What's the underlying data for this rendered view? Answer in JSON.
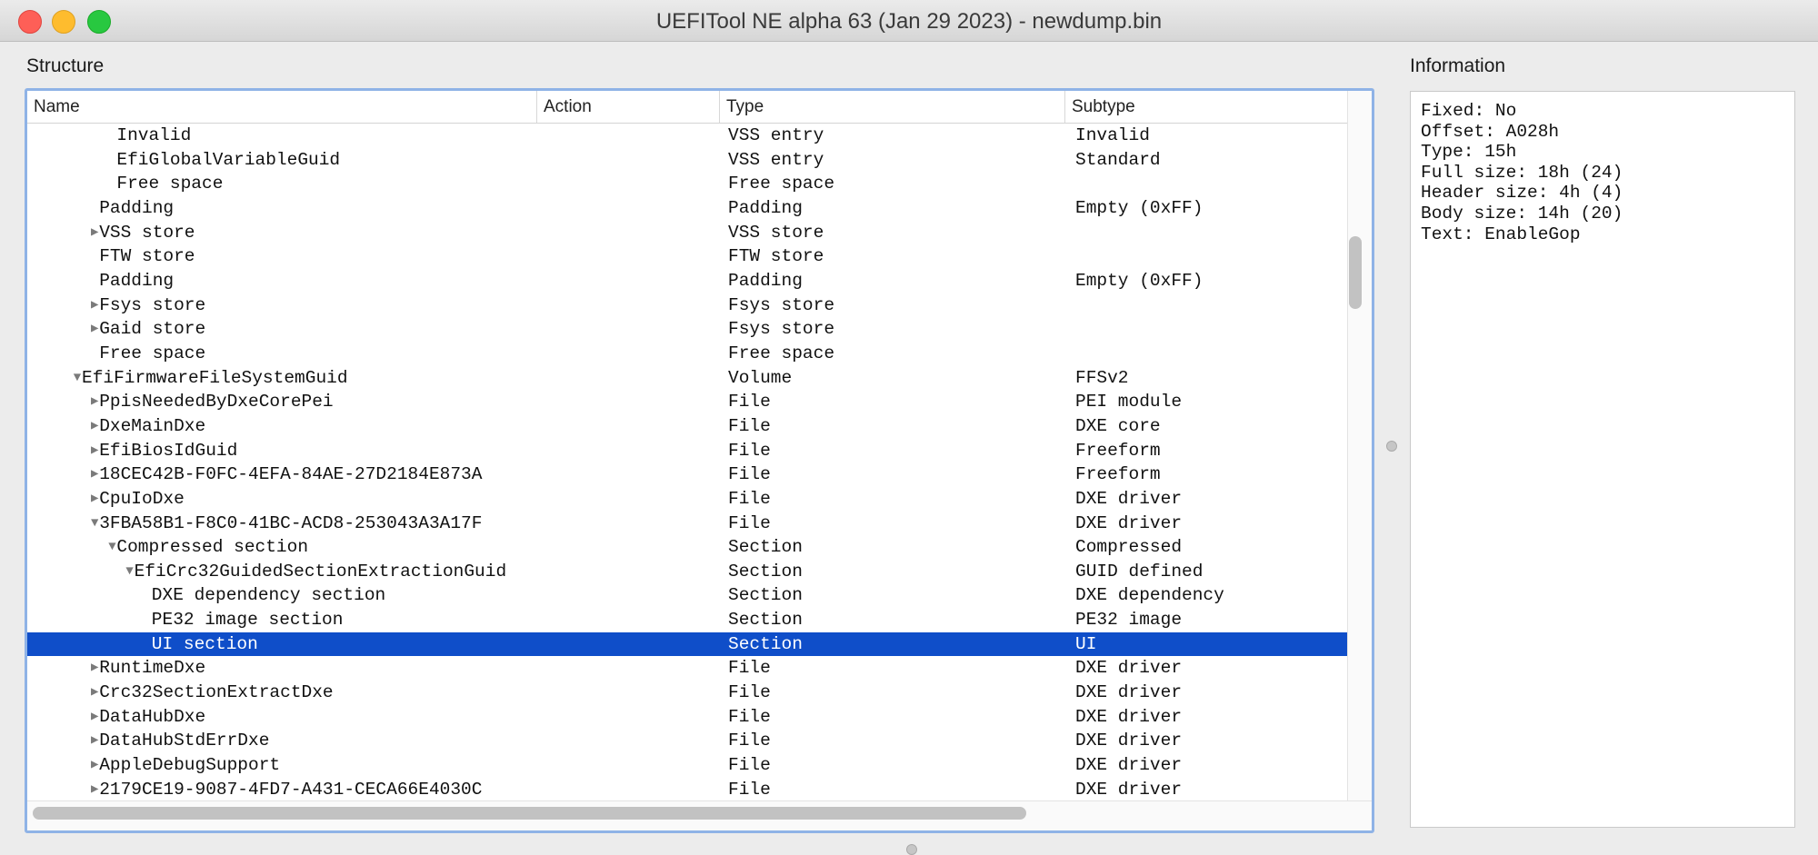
{
  "window": {
    "title": "UEFITool NE alpha 63 (Jan 29 2023) - newdump.bin"
  },
  "structure": {
    "label": "Structure",
    "columns": {
      "name": "Name",
      "action": "Action",
      "type": "Type",
      "subtype": "Subtype"
    },
    "rows": [
      {
        "name": "Invalid",
        "type": "VSS entry",
        "subtype": "Invalid",
        "depth": 3,
        "expander": "none"
      },
      {
        "name": "EfiGlobalVariableGuid",
        "type": "VSS entry",
        "subtype": "Standard",
        "depth": 3,
        "expander": "none"
      },
      {
        "name": "Free space",
        "type": "Free space",
        "subtype": "",
        "depth": 3,
        "expander": "none"
      },
      {
        "name": "Padding",
        "type": "Padding",
        "subtype": "Empty (0xFF)",
        "depth": 2,
        "expander": "none"
      },
      {
        "name": "VSS store",
        "type": "VSS store",
        "subtype": "",
        "depth": 2,
        "expander": "collapsed"
      },
      {
        "name": "FTW store",
        "type": "FTW store",
        "subtype": "",
        "depth": 2,
        "expander": "none"
      },
      {
        "name": "Padding",
        "type": "Padding",
        "subtype": "Empty (0xFF)",
        "depth": 2,
        "expander": "none"
      },
      {
        "name": "Fsys store",
        "type": "Fsys store",
        "subtype": "",
        "depth": 2,
        "expander": "collapsed"
      },
      {
        "name": "Gaid store",
        "type": "Fsys store",
        "subtype": "",
        "depth": 2,
        "expander": "collapsed"
      },
      {
        "name": "Free space",
        "type": "Free space",
        "subtype": "",
        "depth": 2,
        "expander": "none"
      },
      {
        "name": "EfiFirmwareFileSystemGuid",
        "type": "Volume",
        "subtype": "FFSv2",
        "depth": 1,
        "expander": "expanded"
      },
      {
        "name": "PpisNeededByDxeCorePei",
        "type": "File",
        "subtype": "PEI module",
        "depth": 2,
        "expander": "collapsed"
      },
      {
        "name": "DxeMainDxe",
        "type": "File",
        "subtype": "DXE core",
        "depth": 2,
        "expander": "collapsed"
      },
      {
        "name": "EfiBiosIdGuid",
        "type": "File",
        "subtype": "Freeform",
        "depth": 2,
        "expander": "collapsed"
      },
      {
        "name": "18CEC42B-F0FC-4EFA-84AE-27D2184E873A",
        "type": "File",
        "subtype": "Freeform",
        "depth": 2,
        "expander": "collapsed"
      },
      {
        "name": "CpuIoDxe",
        "type": "File",
        "subtype": "DXE driver",
        "depth": 2,
        "expander": "collapsed"
      },
      {
        "name": "3FBA58B1-F8C0-41BC-ACD8-253043A3A17F",
        "type": "File",
        "subtype": "DXE driver",
        "depth": 2,
        "expander": "expanded"
      },
      {
        "name": "Compressed section",
        "type": "Section",
        "subtype": "Compressed",
        "depth": 3,
        "expander": "expanded"
      },
      {
        "name": "EfiCrc32GuidedSectionExtractionGuid",
        "type": "Section",
        "subtype": "GUID defined",
        "depth": 4,
        "expander": "expanded"
      },
      {
        "name": "DXE dependency section",
        "type": "Section",
        "subtype": "DXE dependency",
        "depth": 5,
        "expander": "none"
      },
      {
        "name": "PE32 image section",
        "type": "Section",
        "subtype": "PE32 image",
        "depth": 5,
        "expander": "none"
      },
      {
        "name": "UI section",
        "type": "Section",
        "subtype": "UI",
        "depth": 5,
        "expander": "none",
        "selected": true
      },
      {
        "name": "RuntimeDxe",
        "type": "File",
        "subtype": "DXE driver",
        "depth": 2,
        "expander": "collapsed"
      },
      {
        "name": "Crc32SectionExtractDxe",
        "type": "File",
        "subtype": "DXE driver",
        "depth": 2,
        "expander": "collapsed"
      },
      {
        "name": "DataHubDxe",
        "type": "File",
        "subtype": "DXE driver",
        "depth": 2,
        "expander": "collapsed"
      },
      {
        "name": "DataHubStdErrDxe",
        "type": "File",
        "subtype": "DXE driver",
        "depth": 2,
        "expander": "collapsed"
      },
      {
        "name": "AppleDebugSupport",
        "type": "File",
        "subtype": "DXE driver",
        "depth": 2,
        "expander": "collapsed"
      },
      {
        "name": "2179CE19-9087-4FD7-A431-CECA66E4030C",
        "type": "File",
        "subtype": "DXE driver",
        "depth": 2,
        "expander": "collapsed"
      }
    ]
  },
  "information": {
    "label": "Information",
    "lines": [
      "Fixed: No",
      "Offset: A028h",
      "Type: 15h",
      "Full size: 18h (24)",
      "Header size: 4h (4)",
      "Body size: 14h (20)",
      "Text: EnableGop"
    ]
  },
  "colors": {
    "selection": "#0f4ec9",
    "focus_ring": "#8fb3e6",
    "close": "#fe5f57",
    "minimize": "#febc2e",
    "maximize": "#28c840"
  }
}
